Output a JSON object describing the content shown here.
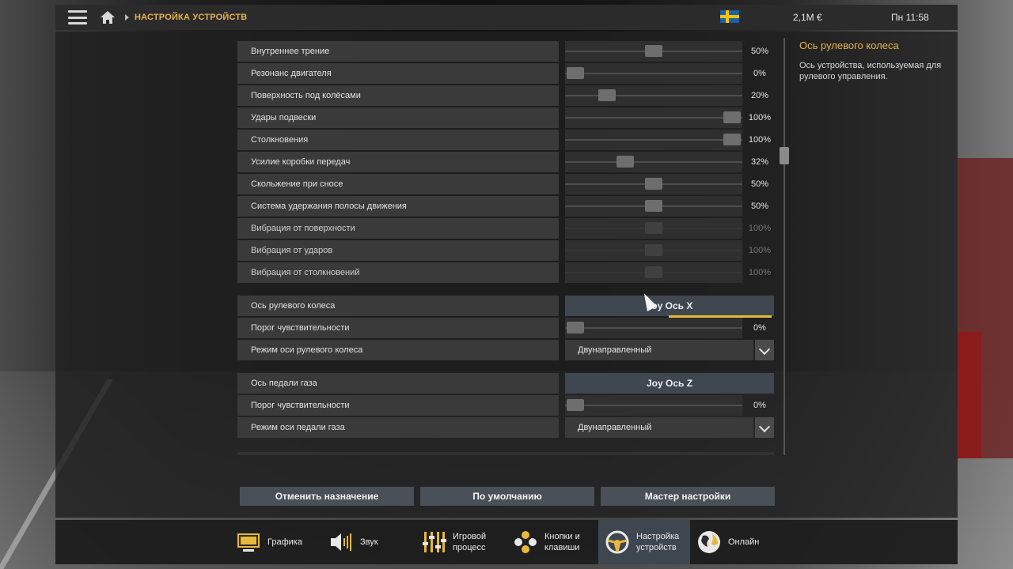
{
  "topbar": {
    "breadcrumb": "НАСТРОЙКА УСТРОЙСТВ",
    "money": "2,1M €",
    "time": "Пн 11:58"
  },
  "settings": {
    "rows": [
      {
        "label": "Внутреннее трение",
        "type": "slider",
        "value": 0.5,
        "pct": "50%",
        "dim": false
      },
      {
        "label": "Резонанс двигателя",
        "type": "slider",
        "value": 0.0,
        "pct": "0%",
        "dim": false
      },
      {
        "label": "Поверхность под колёсами",
        "type": "slider",
        "value": 0.2,
        "pct": "20%",
        "dim": false
      },
      {
        "label": "Удары подвески",
        "type": "slider",
        "value": 1.0,
        "pct": "100%",
        "dim": false
      },
      {
        "label": "Столкновения",
        "type": "slider",
        "value": 1.0,
        "pct": "100%",
        "dim": false
      },
      {
        "label": "Усилие коробки передач",
        "type": "slider",
        "value": 0.32,
        "pct": "32%",
        "dim": false
      },
      {
        "label": "Скольжение при сносе",
        "type": "slider",
        "value": 0.5,
        "pct": "50%",
        "dim": false
      },
      {
        "label": "Система удержания полосы движения",
        "type": "slider",
        "value": 0.5,
        "pct": "50%",
        "dim": false
      },
      {
        "label": "Вибрация от поверхности",
        "type": "slider",
        "value": 0.5,
        "pct": "100%",
        "dim": true
      },
      {
        "label": "Вибрация от ударов",
        "type": "slider",
        "value": 0.5,
        "pct": "100%",
        "dim": true
      },
      {
        "label": "Вибрация от столкновений",
        "type": "slider",
        "value": 0.5,
        "pct": "100%",
        "dim": true
      },
      {
        "label": "Ось рулевого колеса",
        "type": "binding",
        "text": "Joy Ось X",
        "gap_before": true,
        "active": true
      },
      {
        "label": "Порог чувствительности",
        "type": "slider",
        "value": 0.0,
        "pct": "0%",
        "dim": false
      },
      {
        "label": "Режим оси рулевого колеса",
        "type": "dropdown",
        "text": "Двунаправленный"
      },
      {
        "label": "Ось педали газа",
        "type": "binding",
        "text": "Joy Ось Z",
        "gap_before": true,
        "active": false
      },
      {
        "label": "Порог чувствительности",
        "type": "slider",
        "value": 0.0,
        "pct": "0%",
        "dim": false
      },
      {
        "label": "Режим оси педали газа",
        "type": "dropdown",
        "text": "Двунаправленный"
      }
    ]
  },
  "help": {
    "title": "Ось рулевого колеса",
    "text": "Ось устройства, используемая для рулевого управления."
  },
  "actions": {
    "unassign": "Отменить назначение",
    "defaults": "По умолчанию",
    "wizard": "Мастер настройки"
  },
  "nav": {
    "graphics": "Графика",
    "sound": "Звук",
    "gameplay": "Игровой процесс",
    "controls": "Кнопки и клавиши",
    "devices": "Настройка устройств",
    "online": "Онлайн"
  },
  "colors": {
    "accent": "#e8b24c",
    "active_tab": "#3e4650"
  }
}
